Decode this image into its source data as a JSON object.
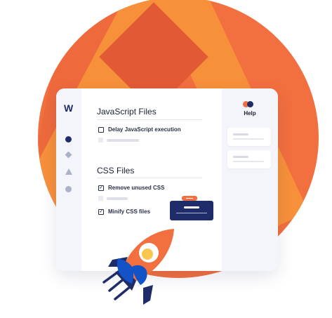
{
  "brand": {
    "logo_text": "W",
    "logo_icon": "wp-rocket-logo"
  },
  "sidebar": {
    "items": [
      {
        "icon": "dashboard-dot-icon"
      },
      {
        "icon": "diamond-icon"
      },
      {
        "icon": "triangle-icon"
      },
      {
        "icon": "circle-icon"
      }
    ]
  },
  "sections": {
    "javascript": {
      "title": "JavaScript Files",
      "option_delay": "Delay JavaScript execution"
    },
    "css": {
      "title": "CSS Files",
      "option_remove_unused": "Remove unused CSS",
      "option_minify": "Minify CSS files"
    }
  },
  "help": {
    "title": "Help"
  },
  "colors": {
    "accent_orange": "#f26f3f",
    "navy": "#1e2d6a",
    "panel_bg": "#f4f5fa"
  }
}
